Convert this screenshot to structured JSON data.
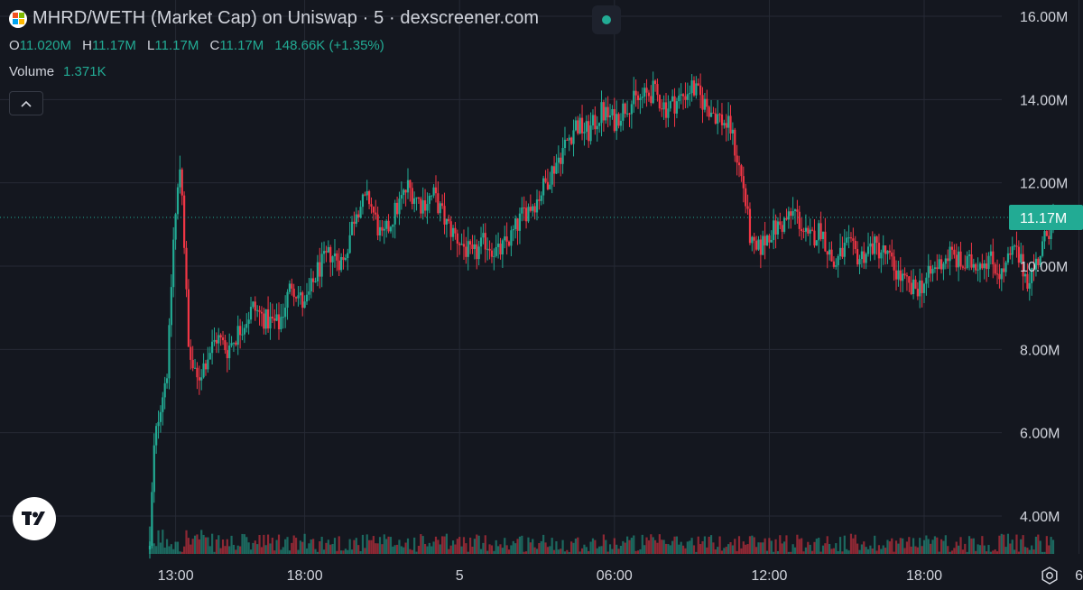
{
  "header": {
    "title": "MHRD/WETH (Market Cap) on Uniswap · 5 · dexscreener.com",
    "ohlc": [
      {
        "key": "O",
        "value": "11.020M"
      },
      {
        "key": "H",
        "value": "11.17M"
      },
      {
        "key": "L",
        "value": "11.17M"
      },
      {
        "key": "C",
        "value": "11.17M"
      }
    ],
    "change": "148.66K (+1.35%)",
    "volume_label": "Volume",
    "volume_value": "1.371K"
  },
  "colors": {
    "background": "#14171f",
    "up": "#22ab94",
    "down": "#f23645",
    "grid": "#262a35",
    "text": "#d1d4dc"
  },
  "chart_data": {
    "type": "candlestick",
    "title": "MHRD/WETH (Market Cap) on Uniswap · 5 · dexscreener.com",
    "y_ticks": [
      "16.00M",
      "14.00M",
      "12.00M",
      "10.00M",
      "8.00M",
      "6.00M",
      "4.00M"
    ],
    "y_tick_values": [
      16,
      14,
      12,
      10,
      8,
      6,
      4
    ],
    "ylim": [
      3.0,
      16.4
    ],
    "x_ticks": [
      "13:00",
      "18:00",
      "5",
      "06:00",
      "12:00",
      "18:00",
      "6"
    ],
    "x_tick_hours": [
      1,
      6,
      12,
      18,
      24,
      30,
      36
    ],
    "x_unit": "hours after 12:00 on day 4",
    "xlim": [
      -0.55,
      40.0
    ],
    "last_price": 11.17,
    "last_price_label": "11.17M",
    "price_path": [
      [
        0.0,
        3.2
      ],
      [
        0.15,
        5.5
      ],
      [
        0.35,
        6.5
      ],
      [
        0.7,
        7.6
      ],
      [
        0.9,
        10.5
      ],
      [
        1.2,
        12.6
      ],
      [
        1.5,
        8.0
      ],
      [
        1.8,
        7.2
      ],
      [
        2.2,
        7.8
      ],
      [
        2.6,
        8.3
      ],
      [
        3.0,
        8.0
      ],
      [
        3.5,
        8.5
      ],
      [
        4.0,
        9.0
      ],
      [
        4.5,
        8.7
      ],
      [
        5.0,
        8.6
      ],
      [
        5.5,
        9.6
      ],
      [
        6.0,
        9.0
      ],
      [
        6.5,
        9.9
      ],
      [
        7.0,
        10.3
      ],
      [
        7.5,
        10.1
      ],
      [
        8.0,
        11.4
      ],
      [
        8.5,
        11.6
      ],
      [
        9.0,
        10.6
      ],
      [
        9.5,
        11.3
      ],
      [
        10.0,
        11.9
      ],
      [
        10.5,
        11.5
      ],
      [
        11.0,
        11.7
      ],
      [
        11.5,
        11.0
      ],
      [
        12.0,
        10.6
      ],
      [
        12.5,
        10.2
      ],
      [
        13.0,
        10.6
      ],
      [
        13.5,
        10.3
      ],
      [
        14.0,
        10.7
      ],
      [
        14.5,
        11.3
      ],
      [
        15.0,
        11.6
      ],
      [
        15.5,
        12.2
      ],
      [
        16.0,
        12.8
      ],
      [
        16.5,
        13.4
      ],
      [
        17.0,
        13.2
      ],
      [
        17.5,
        13.7
      ],
      [
        18.0,
        13.5
      ],
      [
        18.5,
        13.9
      ],
      [
        19.0,
        14.0
      ],
      [
        19.5,
        14.2
      ],
      [
        20.0,
        13.8
      ],
      [
        20.5,
        14.0
      ],
      [
        21.0,
        14.3
      ],
      [
        21.5,
        13.9
      ],
      [
        22.0,
        13.6
      ],
      [
        22.5,
        13.3
      ],
      [
        23.0,
        11.9
      ],
      [
        23.3,
        10.5
      ],
      [
        23.5,
        10.3
      ],
      [
        24.0,
        10.8
      ],
      [
        24.5,
        11.0
      ],
      [
        25.0,
        11.3
      ],
      [
        25.5,
        10.6
      ],
      [
        26.0,
        10.9
      ],
      [
        26.5,
        10.0
      ],
      [
        27.0,
        10.5
      ],
      [
        27.5,
        10.2
      ],
      [
        28.0,
        10.5
      ],
      [
        28.5,
        10.3
      ],
      [
        29.0,
        9.8
      ],
      [
        29.5,
        9.4
      ],
      [
        30.0,
        9.6
      ],
      [
        30.5,
        10.0
      ],
      [
        31.0,
        10.3
      ],
      [
        31.5,
        10.0
      ],
      [
        32.0,
        10.1
      ],
      [
        32.5,
        10.2
      ],
      [
        33.0,
        9.8
      ],
      [
        33.5,
        10.4
      ],
      [
        34.0,
        9.7
      ],
      [
        34.3,
        10.0
      ],
      [
        34.6,
        10.5
      ],
      [
        35.0,
        11.2
      ]
    ],
    "volume_range": [
      0.15,
      1.6
    ]
  },
  "controls": {
    "collapse": "chevron-up-icon",
    "settings": "settings-icon",
    "logo": "tradingview-logo"
  }
}
